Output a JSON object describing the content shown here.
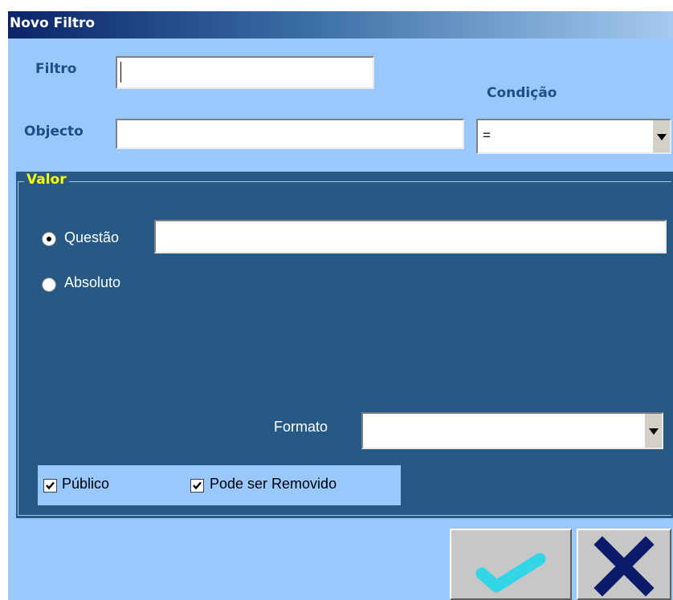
{
  "window": {
    "title": "Novo Filtro"
  },
  "form": {
    "filtro_label": "Filtro",
    "filtro_value": "",
    "objecto_label": "Objecto",
    "objecto_value": "",
    "condicao_label": "Condição",
    "condicao_value": "="
  },
  "valor": {
    "legend": "Valor",
    "questao_label": "Questão",
    "questao_selected": true,
    "questao_value": "",
    "absoluto_label": "Absoluto",
    "absoluto_selected": false,
    "formato_label": "Formato",
    "formato_value": ""
  },
  "options": {
    "publico_label": "Público",
    "publico_checked": true,
    "removivel_label": "Pode ser Removido",
    "removivel_checked": true
  },
  "buttons": {
    "ok_icon": "checkmark-icon",
    "cancel_icon": "x-icon"
  },
  "colors": {
    "form_background": "#99c8ff",
    "panel_background": "#265983",
    "legend_text": "#ffff00",
    "ok_check": "#33d6e6",
    "cancel_x": "#0b1a6b"
  }
}
